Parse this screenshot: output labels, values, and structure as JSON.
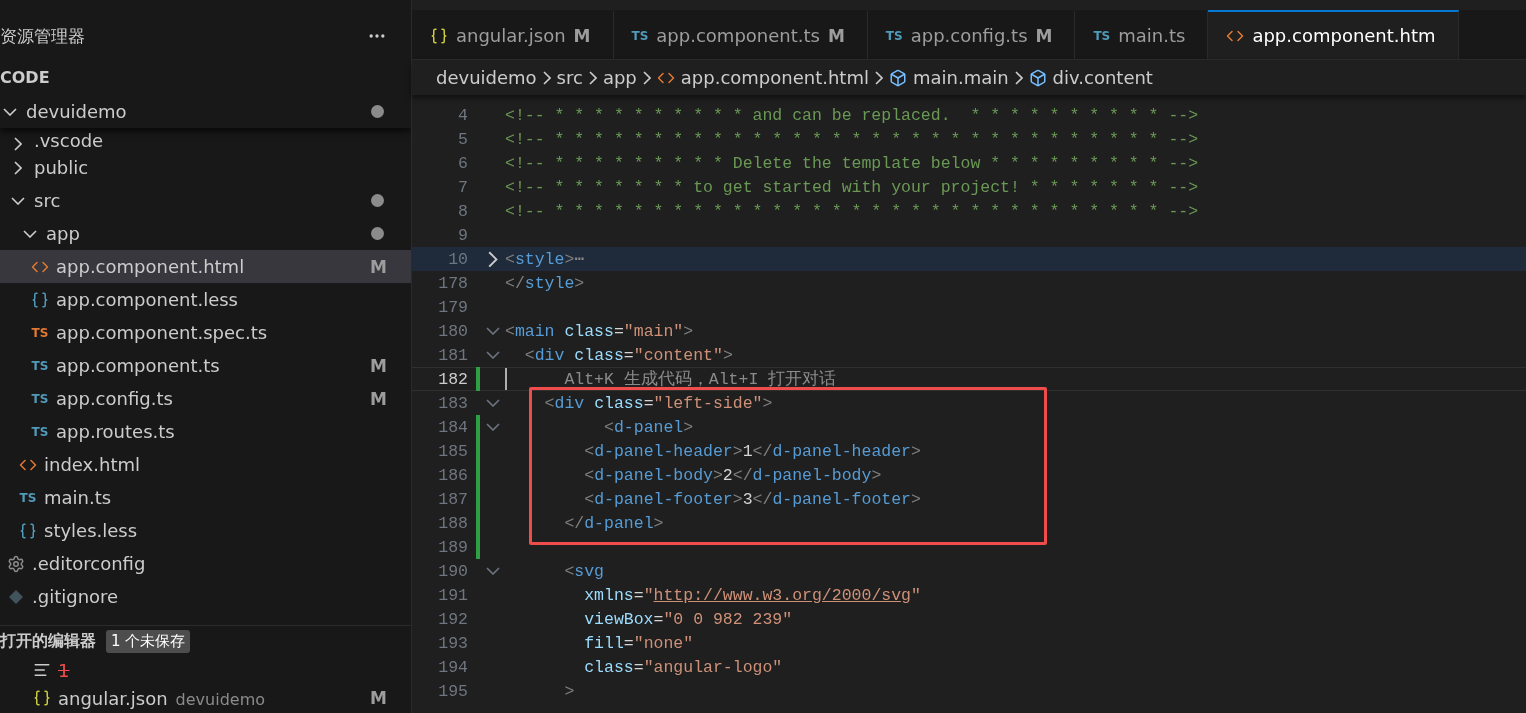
{
  "sidebar": {
    "title": "资源管理器",
    "section": "CODE",
    "tree": [
      {
        "name": "devuidemo",
        "kind": "folder",
        "expanded": true,
        "dot": true,
        "selected": false,
        "children": [
          {
            "name": ".vscode",
            "kind": "folder",
            "expanded": false,
            "selected": false
          },
          {
            "name": "public",
            "kind": "folder",
            "expanded": false,
            "selected": false
          },
          {
            "name": "src",
            "kind": "folder",
            "expanded": true,
            "dot": true,
            "selected": false,
            "children": [
              {
                "name": "app",
                "kind": "folder",
                "expanded": true,
                "dot": true,
                "selected": false,
                "children": [
                  {
                    "name": "app.component.html",
                    "kind": "html",
                    "badge": "M",
                    "selected": true
                  },
                  {
                    "name": "app.component.less",
                    "kind": "less",
                    "selected": false
                  },
                  {
                    "name": "app.component.spec.ts",
                    "kind": "test",
                    "icon_label": "TS",
                    "selected": false
                  },
                  {
                    "name": "app.component.ts",
                    "kind": "ts",
                    "icon_label": "TS",
                    "badge": "M",
                    "selected": false
                  },
                  {
                    "name": "app.config.ts",
                    "kind": "ts",
                    "icon_label": "TS",
                    "badge": "M",
                    "selected": false
                  },
                  {
                    "name": "app.routes.ts",
                    "kind": "ts",
                    "icon_label": "TS",
                    "selected": false
                  }
                ]
              },
              {
                "name": "index.html",
                "kind": "html",
                "selected": false
              },
              {
                "name": "main.ts",
                "kind": "ts",
                "icon_label": "TS",
                "selected": false
              },
              {
                "name": "styles.less",
                "kind": "less",
                "selected": false
              }
            ]
          },
          {
            "name": ".editorconfig",
            "kind": "config",
            "selected": false
          },
          {
            "name": ".gitignore",
            "kind": "git",
            "selected": false
          }
        ]
      }
    ],
    "open_editors": {
      "title": "打开的编辑器",
      "badge": "1 个未保存",
      "items": [
        {
          "name": "1",
          "kind": "text",
          "error": true,
          "selected": false
        },
        {
          "name": "angular.json",
          "kind": "json",
          "folder": "devuidemo",
          "badge": "M",
          "error": false,
          "selected": false
        }
      ]
    }
  },
  "tabs": [
    {
      "label": "angular.json",
      "kind": "json",
      "badge": "M",
      "selected": false
    },
    {
      "label": "app.component.ts",
      "kind": "ts",
      "icon_label": "TS",
      "badge": "M",
      "selected": false
    },
    {
      "label": "app.config.ts",
      "kind": "ts",
      "icon_label": "TS",
      "badge": "M",
      "selected": false
    },
    {
      "label": "main.ts",
      "kind": "ts",
      "icon_label": "TS",
      "selected": false
    },
    {
      "label": "app.component.htm",
      "kind": "html",
      "selected": true
    }
  ],
  "breadcrumb": [
    {
      "label": "devuidemo",
      "kind": "folder"
    },
    {
      "label": "src",
      "kind": "folder"
    },
    {
      "label": "app",
      "kind": "folder"
    },
    {
      "label": "app.component.html",
      "kind": "html"
    },
    {
      "label": "main.main",
      "kind": "element"
    },
    {
      "label": "div.content",
      "kind": "element"
    }
  ],
  "code": [
    {
      "number": "4",
      "tokens": [
        {
          "kind": "comment",
          "s": "<!-- * * * * * * * * * * and can be replaced.  * * * * * * * * * * -->"
        }
      ]
    },
    {
      "number": "5",
      "tokens": [
        {
          "kind": "comment",
          "s": "<!-- * * * * * * * * * * * * * * * * * * * * * * * * * * * * * * * -->"
        }
      ]
    },
    {
      "number": "6",
      "tokens": [
        {
          "kind": "comment",
          "s": "<!-- * * * * * * * * * Delete the template below * * * * * * * * * -->"
        }
      ]
    },
    {
      "number": "7",
      "tokens": [
        {
          "kind": "comment",
          "s": "<!-- * * * * * * * to get started with your project! * * * * * * * -->"
        }
      ]
    },
    {
      "number": "8",
      "tokens": [
        {
          "kind": "comment",
          "s": "<!-- * * * * * * * * * * * * * * * * * * * * * * * * * * * * * * * -->"
        }
      ]
    },
    {
      "number": "9"
    },
    {
      "number": "10",
      "collapsed": true,
      "tokens": [
        {
          "kind": "punct",
          "s": "<"
        },
        {
          "kind": "tag",
          "s": "style"
        },
        {
          "kind": "punct",
          "s": ">"
        },
        {
          "kind": "ellipsis",
          "s": "⋯"
        }
      ]
    },
    {
      "number": "178",
      "tokens": [
        {
          "kind": "punct",
          "s": "</"
        },
        {
          "kind": "tag",
          "s": "style"
        },
        {
          "kind": "punct",
          "s": ">"
        }
      ]
    },
    {
      "number": "179"
    },
    {
      "number": "180",
      "collapsed": false,
      "tokens": [
        {
          "kind": "punct",
          "s": "<"
        },
        {
          "kind": "tag",
          "s": "main"
        },
        {
          "kind": "attr",
          "s": " class"
        },
        {
          "kind": "text",
          "s": "="
        },
        {
          "kind": "string",
          "s": "\"main\""
        },
        {
          "kind": "punct",
          "s": ">"
        }
      ]
    },
    {
      "number": "181",
      "collapsed": false,
      "tokens": [
        {
          "kind": "punct",
          "s": "  <"
        },
        {
          "kind": "tag",
          "s": "div"
        },
        {
          "kind": "attr",
          "s": " class"
        },
        {
          "kind": "text",
          "s": "="
        },
        {
          "kind": "string",
          "s": "\"content\""
        },
        {
          "kind": "punct",
          "s": ">"
        }
      ]
    },
    {
      "number": "182",
      "current": true,
      "changed": true,
      "tokens": [
        {
          "kind": "ghost",
          "s": "      Alt+K 生成代码，Alt+I 打开对话"
        }
      ]
    },
    {
      "number": "183",
      "collapsed": false,
      "boxed": true,
      "tokens": [
        {
          "kind": "punct",
          "s": "    <"
        },
        {
          "kind": "tag",
          "s": "div"
        },
        {
          "kind": "attr",
          "s": " class"
        },
        {
          "kind": "text",
          "s": "="
        },
        {
          "kind": "string",
          "s": "\"left-side\""
        },
        {
          "kind": "punct",
          "s": ">"
        }
      ]
    },
    {
      "number": "184",
      "collapsed": false,
      "changed": true,
      "boxed": true,
      "tokens": [
        {
          "kind": "punct",
          "s": "          <"
        },
        {
          "kind": "tag",
          "s": "d-panel"
        },
        {
          "kind": "punct",
          "s": ">"
        }
      ]
    },
    {
      "number": "185",
      "changed": true,
      "boxed": true,
      "tokens": [
        {
          "kind": "punct",
          "s": "        <"
        },
        {
          "kind": "tag",
          "s": "d-panel-header"
        },
        {
          "kind": "punct",
          "s": ">"
        },
        {
          "kind": "text",
          "s": "1"
        },
        {
          "kind": "punct",
          "s": "</"
        },
        {
          "kind": "tag",
          "s": "d-panel-header"
        },
        {
          "kind": "punct",
          "s": ">"
        }
      ]
    },
    {
      "number": "186",
      "changed": true,
      "boxed": true,
      "tokens": [
        {
          "kind": "punct",
          "s": "        <"
        },
        {
          "kind": "tag",
          "s": "d-panel-body"
        },
        {
          "kind": "punct",
          "s": ">"
        },
        {
          "kind": "text",
          "s": "2"
        },
        {
          "kind": "punct",
          "s": "</"
        },
        {
          "kind": "tag",
          "s": "d-panel-body"
        },
        {
          "kind": "punct",
          "s": ">"
        }
      ]
    },
    {
      "number": "187",
      "changed": true,
      "boxed": true,
      "tokens": [
        {
          "kind": "punct",
          "s": "        <"
        },
        {
          "kind": "tag",
          "s": "d-panel-footer"
        },
        {
          "kind": "punct",
          "s": ">"
        },
        {
          "kind": "text",
          "s": "3"
        },
        {
          "kind": "punct",
          "s": "</"
        },
        {
          "kind": "tag",
          "s": "d-panel-footer"
        },
        {
          "kind": "punct",
          "s": ">"
        }
      ]
    },
    {
      "number": "188",
      "changed": true,
      "boxed": true,
      "tokens": [
        {
          "kind": "punct",
          "s": "      </"
        },
        {
          "kind": "tag",
          "s": "d-panel"
        },
        {
          "kind": "punct",
          "s": ">"
        }
      ]
    },
    {
      "number": "189",
      "changed": true
    },
    {
      "number": "190",
      "collapsed": false,
      "tokens": [
        {
          "kind": "punct",
          "s": "      <"
        },
        {
          "kind": "tag",
          "s": "svg"
        }
      ]
    },
    {
      "number": "191",
      "tokens": [
        {
          "kind": "attr",
          "s": "        xmlns"
        },
        {
          "kind": "text",
          "s": "="
        },
        {
          "kind": "string",
          "s": "\""
        },
        {
          "kind": "link",
          "s": "http://www.w3.org/2000/svg"
        },
        {
          "kind": "string",
          "s": "\""
        }
      ]
    },
    {
      "number": "192",
      "tokens": [
        {
          "kind": "attr",
          "s": "        viewBox"
        },
        {
          "kind": "text",
          "s": "="
        },
        {
          "kind": "string",
          "s": "\"0 0 982 239\""
        }
      ]
    },
    {
      "number": "193",
      "tokens": [
        {
          "kind": "attr",
          "s": "        fill"
        },
        {
          "kind": "text",
          "s": "="
        },
        {
          "kind": "string",
          "s": "\"none\""
        }
      ]
    },
    {
      "number": "194",
      "tokens": [
        {
          "kind": "attr",
          "s": "        class"
        },
        {
          "kind": "text",
          "s": "="
        },
        {
          "kind": "string",
          "s": "\"angular-logo\""
        }
      ]
    },
    {
      "number": "195",
      "tokens": [
        {
          "kind": "punct",
          "s": "      >"
        }
      ]
    }
  ]
}
